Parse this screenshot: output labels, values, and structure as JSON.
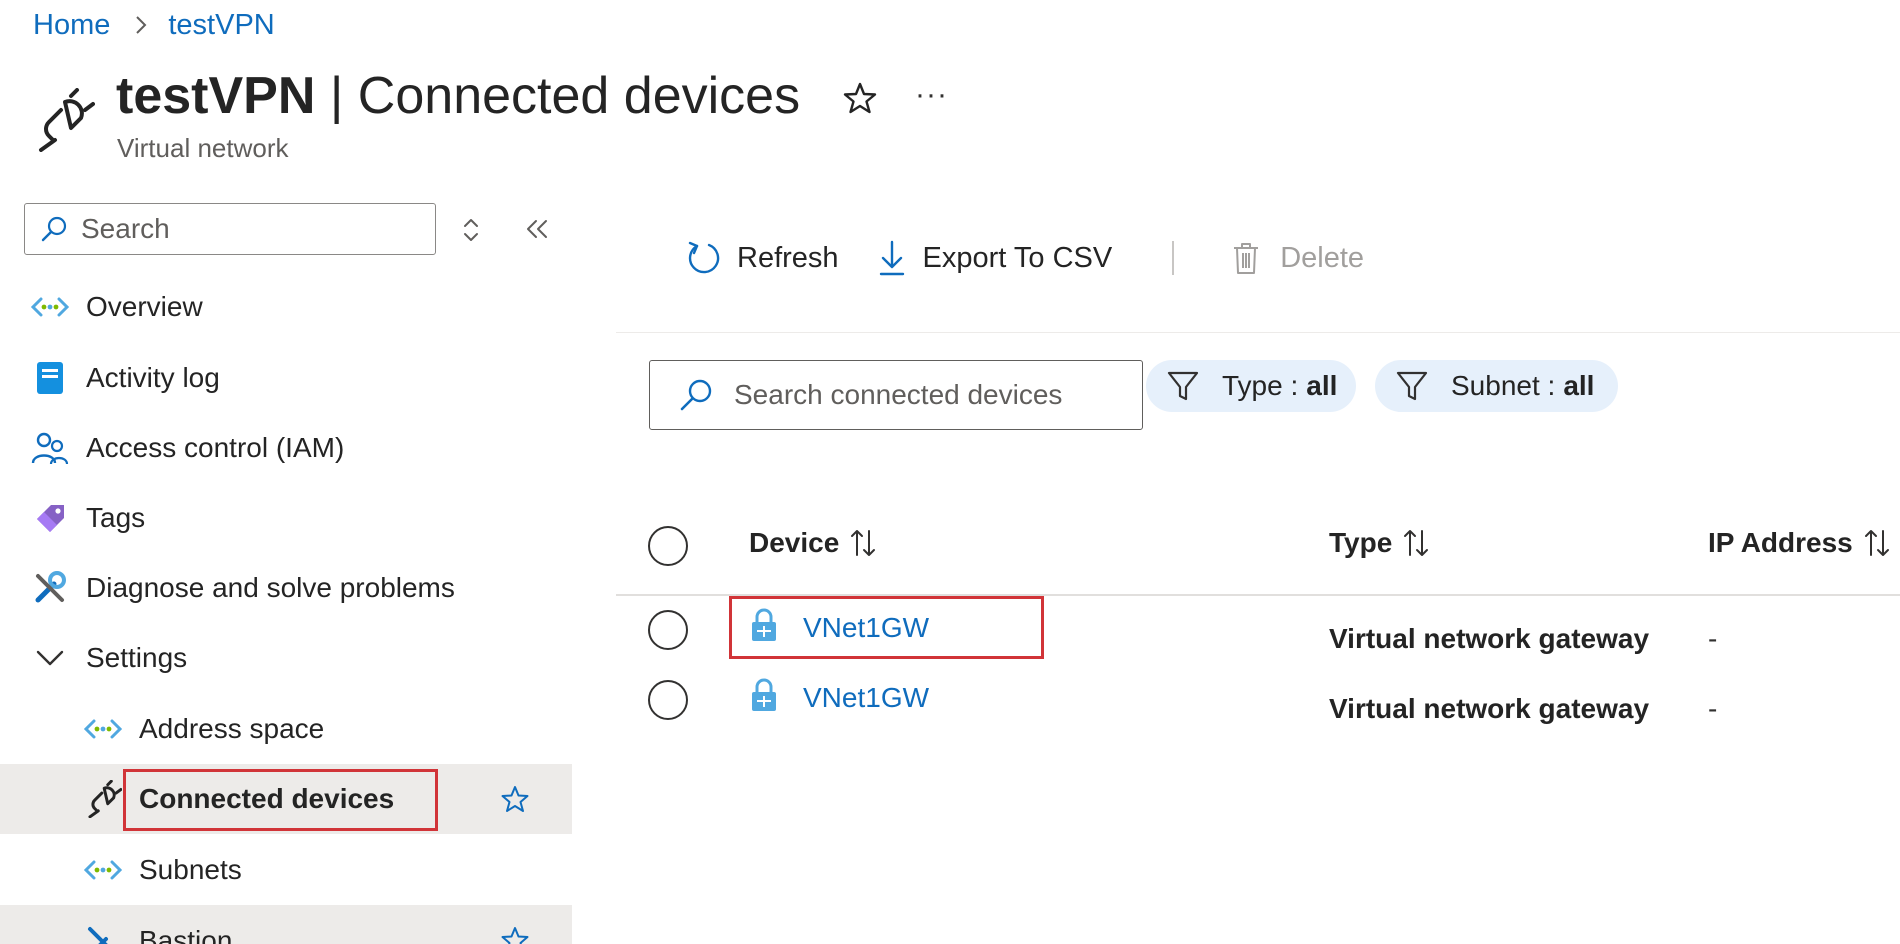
{
  "breadcrumb": {
    "home": "Home",
    "current": "testVPN"
  },
  "header": {
    "title_strong": "testVPN",
    "title_rest": " | Connected devices",
    "subtitle": "Virtual network",
    "more": "···"
  },
  "sidebar": {
    "search_placeholder": "Search",
    "items": [
      {
        "label": "Overview",
        "icon": "virtual-network-icon"
      },
      {
        "label": "Activity log",
        "icon": "activity-log-icon"
      },
      {
        "label": "Access control (IAM)",
        "icon": "people-icon"
      },
      {
        "label": "Tags",
        "icon": "tag-icon"
      },
      {
        "label": "Diagnose and solve problems",
        "icon": "wrench-icon"
      },
      {
        "label": "Settings",
        "icon": "chevron-down-icon"
      },
      {
        "label": "Address space",
        "icon": "virtual-network-icon"
      },
      {
        "label": "Connected devices",
        "icon": "plug-icon",
        "active": true
      },
      {
        "label": "Subnets",
        "icon": "virtual-network-icon"
      },
      {
        "label": "Bastion",
        "icon": "bastion-icon"
      }
    ]
  },
  "toolbar": {
    "refresh": "Refresh",
    "export": "Export To CSV",
    "delete": "Delete"
  },
  "filters": {
    "search_placeholder": "Search connected devices",
    "type_label": "Type :",
    "type_value": "all",
    "subnet_label": "Subnet :",
    "subnet_value": "all"
  },
  "table": {
    "columns": [
      "Device",
      "Type",
      "IP Address"
    ],
    "rows": [
      {
        "device": "VNet1GW",
        "type": "Virtual network gateway",
        "ip": "-"
      },
      {
        "device": "VNet1GW",
        "type": "Virtual network gateway",
        "ip": "-"
      }
    ]
  },
  "colors": {
    "link": "#0f6cbd",
    "highlight": "#d13438",
    "active_bg": "#edebe9",
    "pill_bg": "#e6f0fb"
  }
}
